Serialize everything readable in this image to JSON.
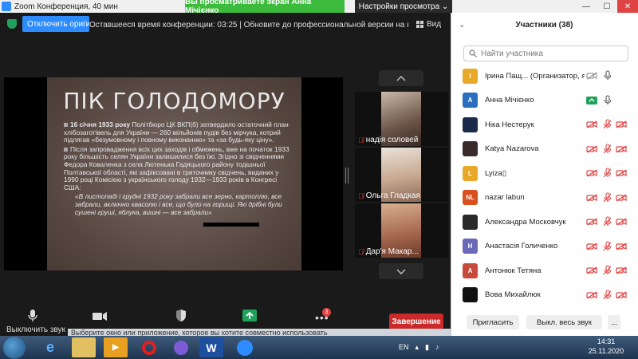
{
  "window": {
    "title": "Zoom Конференция, 40 мин",
    "share_banner": "Вы просматриваете экран Анна Мічієнко",
    "view_settings": "Настройки просмотра ⌄",
    "min": "—",
    "max": "☐",
    "close": "✕"
  },
  "meeting_bar": {
    "stop_remote_label": "Отключить оригин...",
    "time_message": "Оставшееся время конференции: 03:25 | Обновите до профессиональной версии на вариант...",
    "view_label": "Вид"
  },
  "slide": {
    "title": "ПІК ГОЛОДОМОРУ",
    "para1_bold": "16 січня 1933 року",
    "para1_rest": " Політбюро ЦК ВКП(б) затвердило остаточний план хлібозаготівель для України — 260 мільйонів пудів без мірчука, котрий підлягав «безумовному і повному виконанню» та «за будь-яку ціну».",
    "para2": "Після запровадження всіх цих заходів і обмежень, вже на початок 1933 року більшість селян України залишилися без їжі. Згідно зі свідченнями Федора Коваленка з села Лютенька Гадяцького району тодішньої Полтавської області, які зафіксовані в триточнику свідчень, виданих у 1990 році Комісією з українського голоду 1932—1933 років в Конгресі США:",
    "quote": "«В листопаді і грудні 1932 року забрали все зерно, картоплю, все забрали, включно квасолю і все, що було на горищі. Які дрібні були сушені груші, яблука, вишні — все забрали»"
  },
  "tiles": [
    {
      "name": "надія соловей",
      "muted": true
    },
    {
      "name": "Ольга Гладкая",
      "muted": true
    },
    {
      "name": "Дар'я Макар...",
      "muted": true
    }
  ],
  "toolbar": {
    "mute_label": "Выключить звук",
    "participants_badge": "3",
    "end_label": "Завершение"
  },
  "panel": {
    "title": "Участники (38)",
    "search_placeholder": "Найти участника",
    "invite_label": "Пригласить",
    "mute_all_label": "Выкл. весь звук",
    "more_label": "...",
    "participants": [
      {
        "initial": "І",
        "color": "#e8a92a",
        "name": "Ірина Пащ... (Организатор, я)",
        "video": "off-gray",
        "mic": "on"
      },
      {
        "initial": "А",
        "color": "#2a6ebd",
        "name": "Анна Мічієнко",
        "video": "on-green",
        "mic": "on"
      },
      {
        "initial": "",
        "color": "#1a2a4a",
        "name": "Ніка Нестерук",
        "video": "off-red",
        "mic": "off"
      },
      {
        "initial": "",
        "color": "#3a2a2a",
        "name": "Katya Nazarova",
        "video": "off-red",
        "mic": "off"
      },
      {
        "initial": "L",
        "color": "#e8a92a",
        "name": "Lyiza▯",
        "video": "off-red",
        "mic": "off"
      },
      {
        "initial": "NL",
        "color": "#d9501e",
        "name": "nazar labun",
        "video": "off-red",
        "mic": "off"
      },
      {
        "initial": "",
        "color": "#2a2a2a",
        "name": "Александра Московчук",
        "video": "off-red",
        "mic": "off"
      },
      {
        "initial": "Н",
        "color": "#6a6ab8",
        "name": "Анастасія Голиченко",
        "video": "off-red",
        "mic": "off"
      },
      {
        "initial": "А",
        "color": "#c84a3a",
        "name": "Антонюк Тетяна",
        "video": "off-red",
        "mic": "off"
      },
      {
        "initial": "",
        "color": "#111111",
        "name": "Вова Михайлюк",
        "video": "off-red",
        "mic": "off"
      }
    ]
  },
  "notification": "Выберите окно или приложение, которое вы хотите совместно использовать",
  "taskbar": {
    "lang": "EN",
    "time": "14:31",
    "date": "25.11.2020",
    "word_label": "W"
  }
}
